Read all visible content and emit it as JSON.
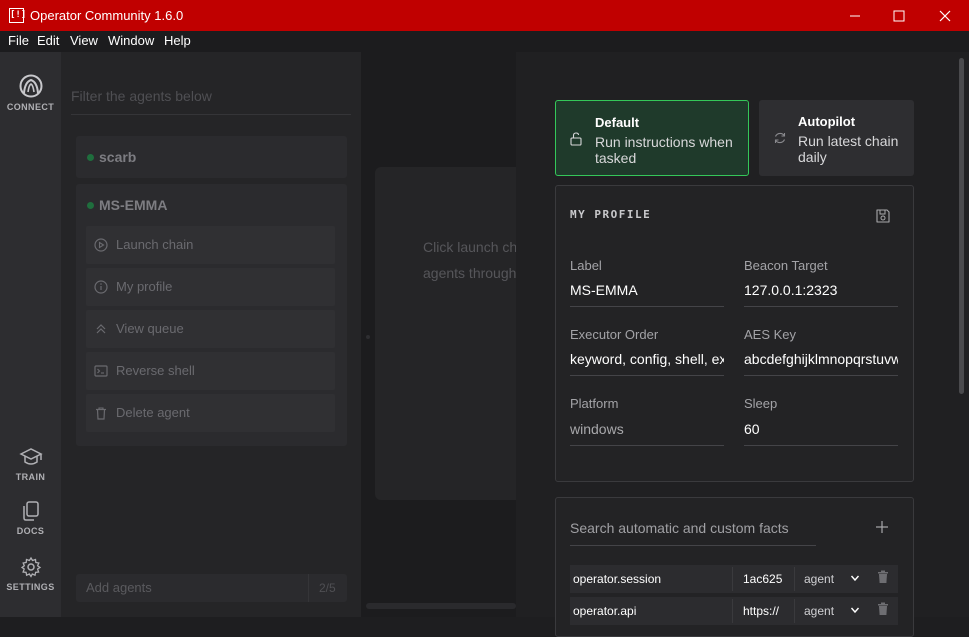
{
  "window": {
    "title": "Operator Community 1.6.0",
    "app_icon": "[!]"
  },
  "menu": [
    "File",
    "Edit",
    "View",
    "Window",
    "Help"
  ],
  "nav": {
    "connect": "CONNECT",
    "train": "TRAIN",
    "docs": "DOCS",
    "settings": "SETTINGS"
  },
  "agents": {
    "filter_placeholder": "Filter the agents below",
    "list": [
      {
        "name": "scarb"
      },
      {
        "name": "MS-EMMA"
      }
    ],
    "actions": [
      "Launch chain",
      "My profile",
      "View queue",
      "Reverse shell",
      "Delete agent"
    ],
    "add_placeholder": "Add agents",
    "count": "2/5"
  },
  "center": {
    "line1": "Click launch ch",
    "line2": "agents through"
  },
  "modes": {
    "default": {
      "title": "Default",
      "desc": "Run instructions when tasked"
    },
    "autopilot": {
      "title": "Autopilot",
      "desc": "Run latest chain daily"
    }
  },
  "profile": {
    "title": "MY PROFILE",
    "label": {
      "label": "Label",
      "value": "MS-EMMA"
    },
    "beacon": {
      "label": "Beacon Target",
      "value": "127.0.0.1:2323"
    },
    "executor": {
      "label": "Executor Order",
      "value": "keyword, config, shell, exi"
    },
    "aes": {
      "label": "AES Key",
      "value": "abcdefghijklmnopqrstuvw"
    },
    "platform": {
      "label": "Platform",
      "value": "windows"
    },
    "sleep": {
      "label": "Sleep",
      "value": "60"
    }
  },
  "facts": {
    "search_placeholder": "Search automatic and custom facts",
    "rows": [
      {
        "name": "operator.session",
        "value": "1ac625",
        "source": "agent"
      },
      {
        "name": "operator.api",
        "value": "https://",
        "source": "agent"
      }
    ]
  },
  "colors": {
    "titlebar": "#c00000",
    "accent_green": "#34c759"
  }
}
